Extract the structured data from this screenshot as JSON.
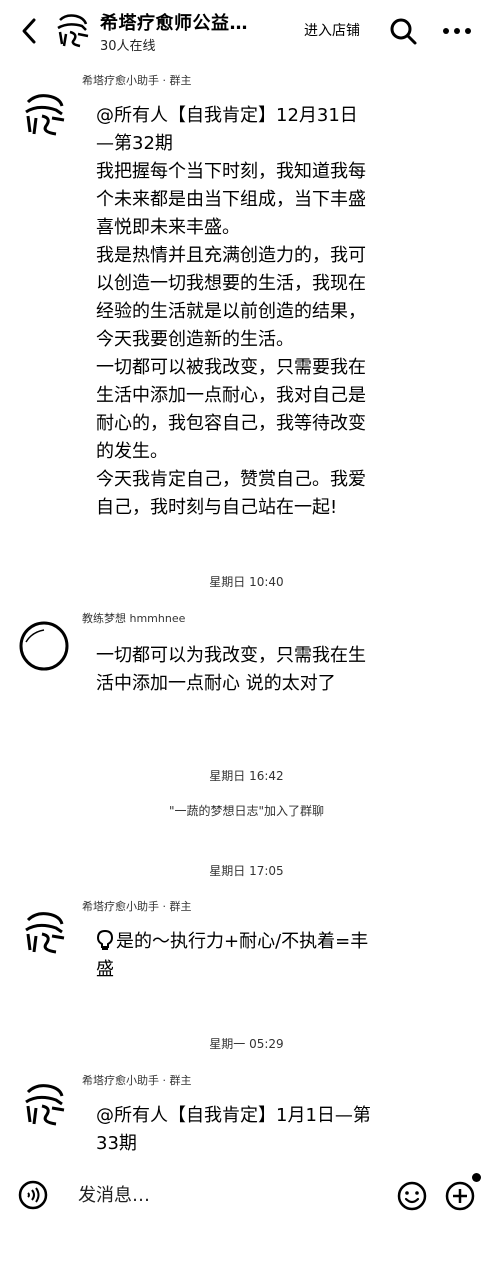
{
  "header": {
    "title": "希塔疗愈师公益…",
    "online": "30人在线",
    "store_link": "进入店铺"
  },
  "messages": [
    {
      "sender": "希塔疗愈小助手 · 群主",
      "lines": [
        "@所有人【自我肯定】12月31日",
        "—第32期",
        "我把握每个当下时刻，我知道我每",
        "个未来都是由当下组成，当下丰盛",
        "喜悦即未来丰盛。",
        "我是热情并且充满创造力的，我可",
        "以创造一切我想要的生活，我现在",
        "经验的生活就是以前创造的结果，",
        "今天我要创造新的生活。",
        "一切都可以被我改变，只需要我在",
        "生活中添加一点耐心，我对自己是",
        "耐心的，我包容自己，我等待改变",
        "的发生。",
        "今天我肯定自己，赞赏自己。我爱",
        "自己，我时刻与自己站在一起!"
      ]
    },
    {
      "time": "星期日 10:40",
      "sender": "教练梦想 hmmhnee",
      "lines": [
        "一切都可以为我改变，只需我在生",
        "活中添加一点耐心 说的太对了"
      ]
    },
    {
      "time": "星期日 16:42",
      "notice": "\"一蔬的梦想日志\"加入了群聊"
    },
    {
      "time": "星期日 17:05",
      "sender": "希塔疗愈小助手 · 群主",
      "lines": [
        "是的～执行力+耐心/不执着=丰",
        "盛"
      ]
    },
    {
      "time": "星期一 05:29",
      "sender": "希塔疗愈小助手 · 群主",
      "lines": [
        "@所有人【自我肯定】1月1日—第",
        "33期"
      ]
    }
  ],
  "composer": {
    "placeholder": "发消息…"
  },
  "icons": [
    "back-icon",
    "group-avatar",
    "search-icon",
    "more-icon",
    "voice-icon",
    "emoji-icon",
    "plus-icon",
    "lightbulb-icon"
  ]
}
